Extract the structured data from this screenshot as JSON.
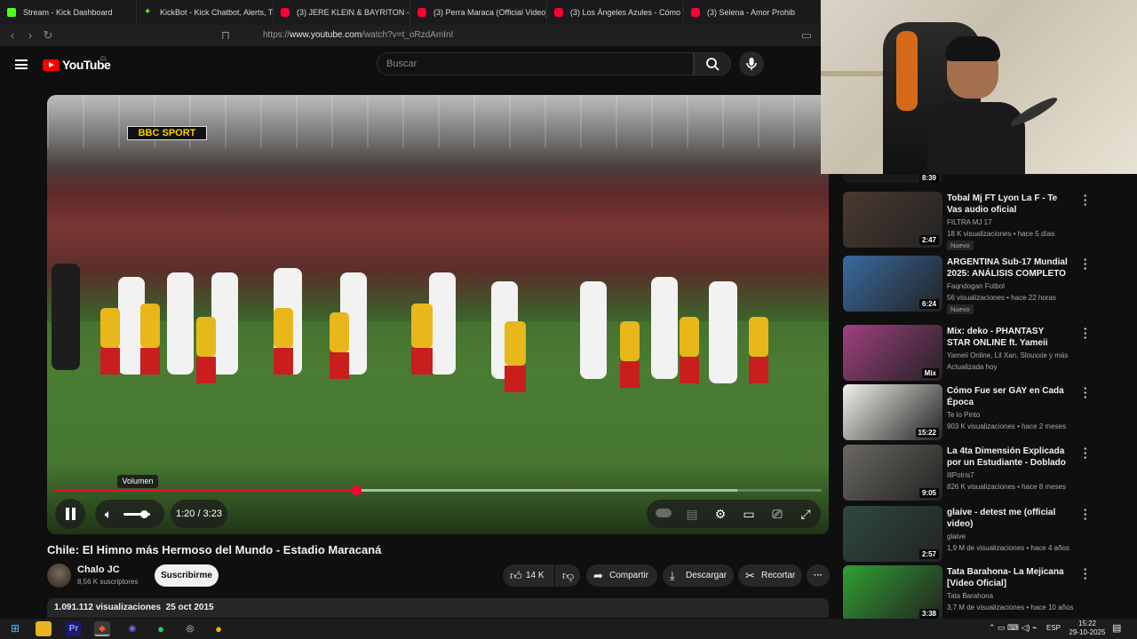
{
  "browser": {
    "tabs": [
      {
        "label": "Stream - Kick Dashboard",
        "icon": "kick-icon"
      },
      {
        "label": "KickBot - Kick Chatbot, Alerts, TTS, C",
        "icon": "kickbot-icon"
      },
      {
        "label": "(3) JERE KLEIN & BAYRITON - TU Y YO",
        "icon": "youtube-icon"
      },
      {
        "label": "(3) Perra Maraca (Official Video) - Yo",
        "icon": "youtube-icon"
      },
      {
        "label": "(3) Los Ángeles Azules - Cómo Te Vo",
        "icon": "youtube-icon"
      },
      {
        "label": "(3) Selena - Amor Prohib",
        "icon": "youtube-icon"
      }
    ],
    "url_prefix": "https://",
    "url_domain": "www.youtube.com",
    "url_path": "/watch?v=t_oRzdAmInI"
  },
  "header": {
    "logo_text": "YouTube",
    "country_code": "CL",
    "search_placeholder": "Buscar"
  },
  "player": {
    "overlay_logo": "BBC SPORT",
    "volume_tooltip": "Volumen",
    "time_display": "1:20 / 3:23",
    "played_fraction": 0.394,
    "buffered_fraction": 0.89,
    "volume_fraction": 0.75,
    "state": "playing"
  },
  "video": {
    "title": "Chile: El Himno más Hermoso del Mundo - Estadio Maracaná",
    "channel": "Chalo JC",
    "subscribers": "8,56 K suscriptores",
    "subscribe_label": "Suscribirme",
    "likes": "14 K",
    "share_label": "Compartir",
    "download_label": "Descargar",
    "clip_label": "Recortar",
    "views": "1.091.112 visualizaciones",
    "date": "25 oct 2015"
  },
  "sidebar": {
    "partial_duration": "8:39",
    "items": [
      {
        "title": "Tobal Mj FT Lyon La F - Te Vas audio oficial",
        "channel": "FILTRA MJ 17",
        "meta": "18 K visualizaciones • hace 5 días",
        "badge": "Nuevo",
        "duration": "2:47",
        "thumb": "#4a3a30"
      },
      {
        "title": "ARGENTINA Sub-17 Mundial 2025: ANÁLISIS COMPLETO d...",
        "channel": "Faqndogan Futbol",
        "meta": "56 visualizaciones • hace 22 horas",
        "badge": "Nuevo",
        "duration": "6:24",
        "thumb": "#3a6aa0"
      },
      {
        "title": "Mix: deko - PHANTASY STAR ONLINE ft. Yameii (Official ...",
        "channel": "Yameii Online, Lil Xan, Slouxxie y más",
        "meta": "Actualizada hoy",
        "badge": "",
        "duration": "Mix",
        "thumb": "#a04080"
      },
      {
        "title": "Cómo Fue ser GAY en Cada Época",
        "channel": "Te lo Pinto",
        "meta": "903 K visualizaciones • hace 2 meses",
        "badge": "",
        "duration": "15:22",
        "thumb": "#f2f0ea"
      },
      {
        "title": "La 4ta Dimensión Explicada por un Estudiante - Doblado al ...",
        "channel": "IllPotris7",
        "meta": "826 K visualizaciones • hace 8 meses",
        "badge": "",
        "duration": "9:05",
        "thumb": "#6a6860"
      },
      {
        "title": "glaive - detest me (official video)",
        "channel": "glaive",
        "meta": "1,9 M de visualizaciones • hace 4 años",
        "badge": "",
        "duration": "2:57",
        "thumb": "#2e4a40"
      },
      {
        "title": "Tata Barahona- La Mejicana [Video Oficial]",
        "channel": "Tata Barahona",
        "meta": "3,7 M de visualizaciones • hace 10 años",
        "badge": "",
        "duration": "3:38",
        "thumb": "#2fa030"
      }
    ]
  },
  "taskbar": {
    "language": "ESP",
    "time": "15:22",
    "date": "29-10-2025"
  },
  "colors": {
    "accent": "#ff0033",
    "background": "#0f0f0f"
  }
}
